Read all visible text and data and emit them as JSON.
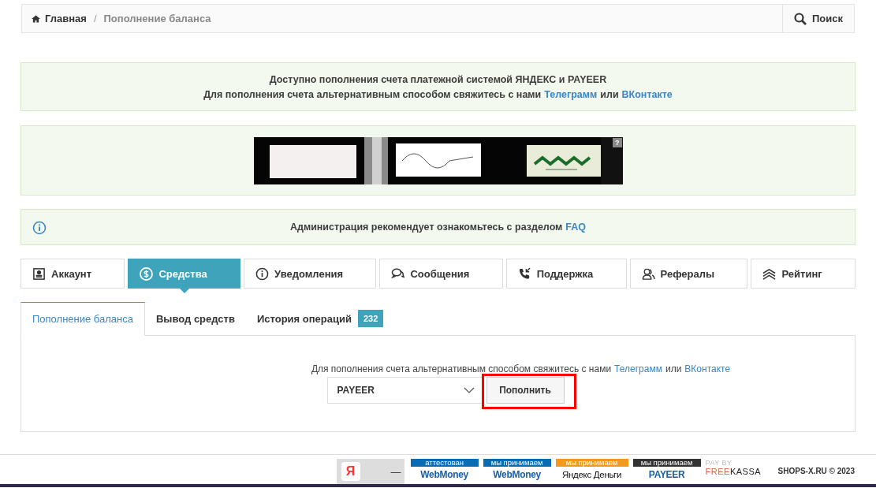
{
  "breadcrumb": [
    {
      "label": "Главная",
      "selected": false
    },
    {
      "label": "Пополнение баланса",
      "selected": true
    }
  ],
  "breadcrumb_separator": "/",
  "search_button": "Поиск",
  "notice": {
    "line_1": "Доступно пополнения счета платежной системой ЯНДЕКС и PAYEER",
    "line_2_text": "Для пополнения счета альтернативным способом свяжитесь с нами",
    "link_1": "Телеграмм",
    "middle": "или",
    "link_2": "ВКонтакте"
  },
  "banner": {
    "kind": "picture",
    "help": "?"
  },
  "info": {
    "text": "Администрация рекомендует ознакомьтесь с разделом",
    "link": "FAQ"
  },
  "tabs": [
    {
      "label": "Аккаунт",
      "kind": "account",
      "selected": false
    },
    {
      "label": "Средства",
      "kind": "money",
      "selected": true
    },
    {
      "label": "Уведомления",
      "kind": "info",
      "selected": false
    },
    {
      "label": "Сообщения",
      "kind": "chat",
      "selected": false
    },
    {
      "label": "Поддержка",
      "kind": "phone",
      "selected": false
    },
    {
      "label": "Рефералы",
      "kind": "users",
      "selected": false
    },
    {
      "label": "Рейтинг",
      "kind": "layers",
      "selected": false
    }
  ],
  "subtabs": [
    {
      "label": "Пополнение баланса",
      "selected": true
    },
    {
      "label": "Вывод средств",
      "selected": false
    },
    {
      "label": "История операций",
      "badge": "232",
      "selected": false
    }
  ],
  "panel": {
    "text": "Для пополнения счета альтернативным способом свяжитесь с нами",
    "link_1": "Телеграмм",
    "middle": "или",
    "link_2": "ВКонтакте",
    "select_value": "PAYEER",
    "button": "Пополнить",
    "button_highlighted": true
  },
  "footer": {
    "badges": [
      {
        "caption": "аттестован",
        "name": "WebMoney",
        "color": "#0a6bb3"
      },
      {
        "caption": "мы принимаем",
        "name": "WebMoney",
        "color": "#0a6bb3"
      },
      {
        "caption": "мы принимаем",
        "name": "Яндекс Деньги",
        "color": "#f39a1d"
      },
      {
        "caption": "мы принимаем",
        "name": "PAYEER",
        "color": "#333333"
      }
    ],
    "freekassa": {
      "top": "PAY BY",
      "left": "FREE",
      "right": "KASSA"
    },
    "yandex_letter": "Я",
    "dash": "—",
    "copyright": "SHOPS-X.RU © 2023"
  }
}
